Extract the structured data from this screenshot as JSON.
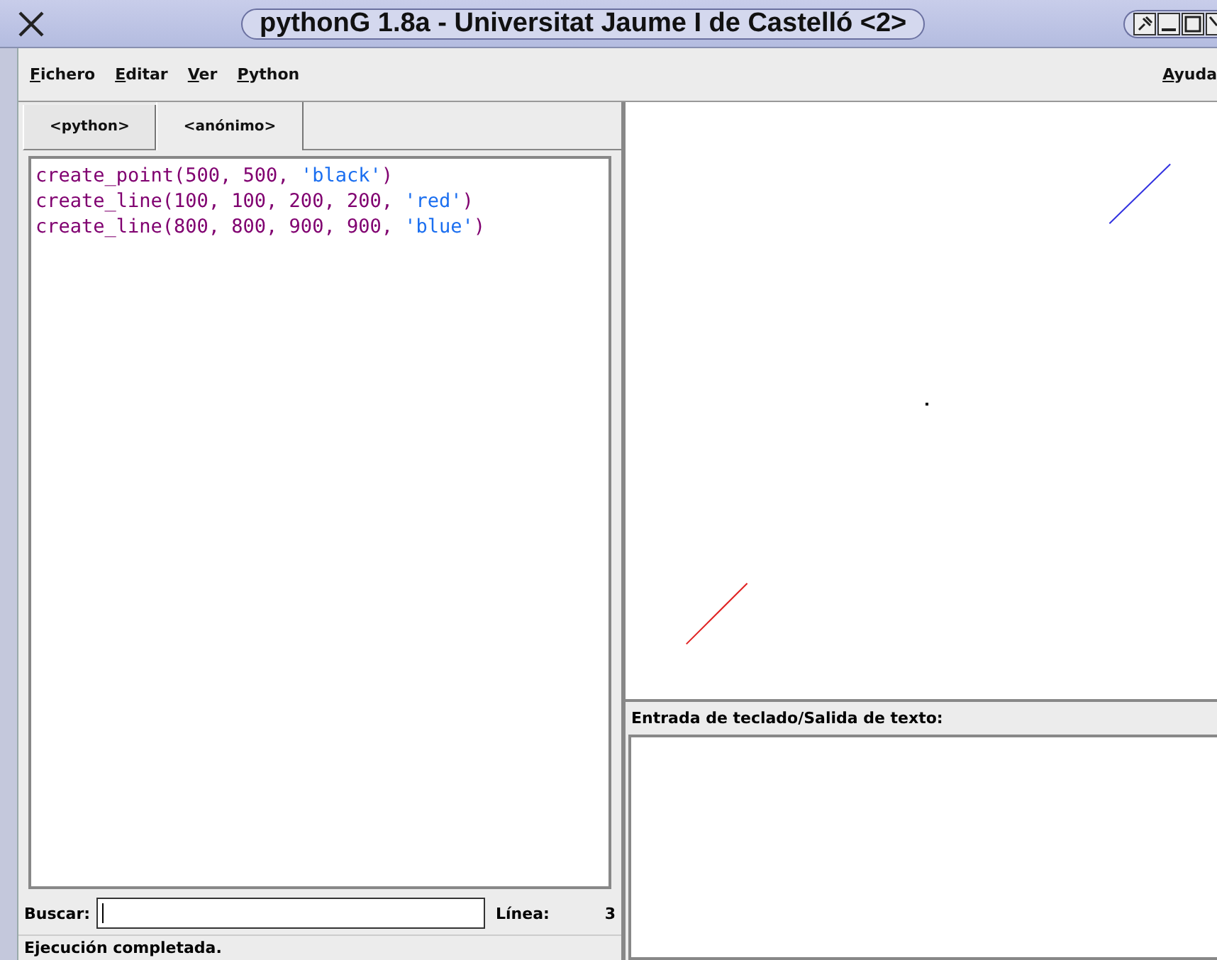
{
  "window": {
    "title": "pythonG 1.8a - Universitat Jaume I de Castelló <2>"
  },
  "menu": {
    "items": [
      {
        "label": "Fichero"
      },
      {
        "label": "Editar"
      },
      {
        "label": "Ver"
      },
      {
        "label": "Python"
      }
    ],
    "help": {
      "label": "Ayuda"
    }
  },
  "tabs": [
    {
      "label": "<python>",
      "selected": false
    },
    {
      "label": "<anónimo>",
      "selected": true
    }
  ],
  "editor": {
    "lines": [
      [
        {
          "kind": "code",
          "text": "create_point(500, 500, "
        },
        {
          "kind": "string",
          "text": "'black'"
        },
        {
          "kind": "code",
          "text": ")"
        }
      ],
      [
        {
          "kind": "code",
          "text": "create_line(100, 100, 200, 200, "
        },
        {
          "kind": "string",
          "text": "'red'"
        },
        {
          "kind": "code",
          "text": ")"
        }
      ],
      [
        {
          "kind": "code",
          "text": "create_line(800, 800, 900, 900, "
        },
        {
          "kind": "string",
          "text": "'blue'"
        },
        {
          "kind": "code",
          "text": ")"
        }
      ]
    ]
  },
  "search": {
    "label": "Buscar:",
    "line_label": "Línea:",
    "line_value": "3"
  },
  "status_bar": "Ejecución completada.",
  "output": {
    "label": "Entrada de teclado/Salida de texto:"
  }
}
